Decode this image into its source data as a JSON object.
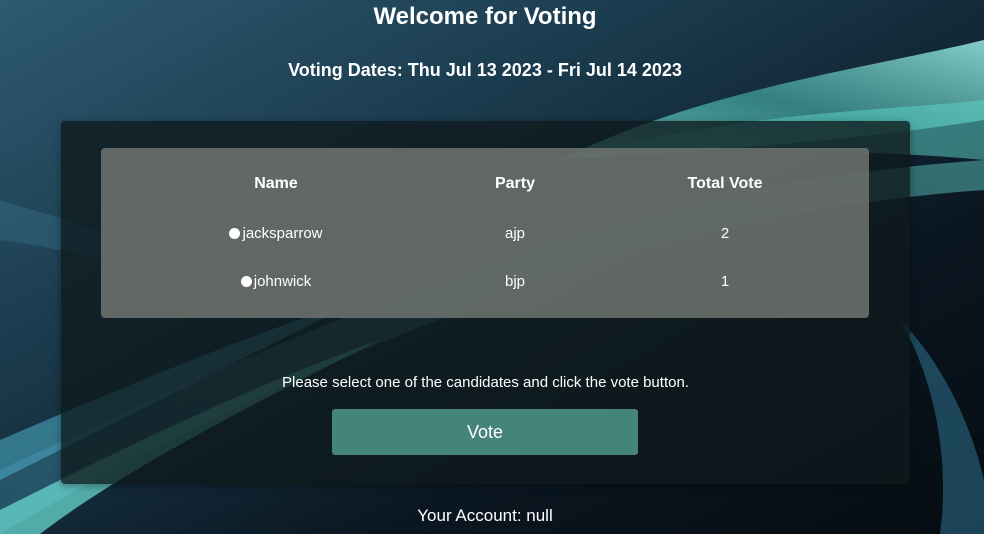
{
  "header": {
    "title": "Welcome for Voting",
    "dates": "Voting Dates: Thu Jul 13 2023 - Fri Jul 14 2023"
  },
  "table": {
    "headers": [
      "Name",
      "Party",
      "Total Vote"
    ],
    "rows": [
      {
        "name": "jacksparrow",
        "party": "ajp",
        "votes": "2"
      },
      {
        "name": "johnwick",
        "party": "bjp",
        "votes": "1"
      }
    ]
  },
  "instructions": "Please select one of the candidates and click the vote button.",
  "vote_button": "Vote",
  "account": "Your Account: null",
  "colors": {
    "button": "#44847a",
    "accent": "#6ee6d2"
  }
}
